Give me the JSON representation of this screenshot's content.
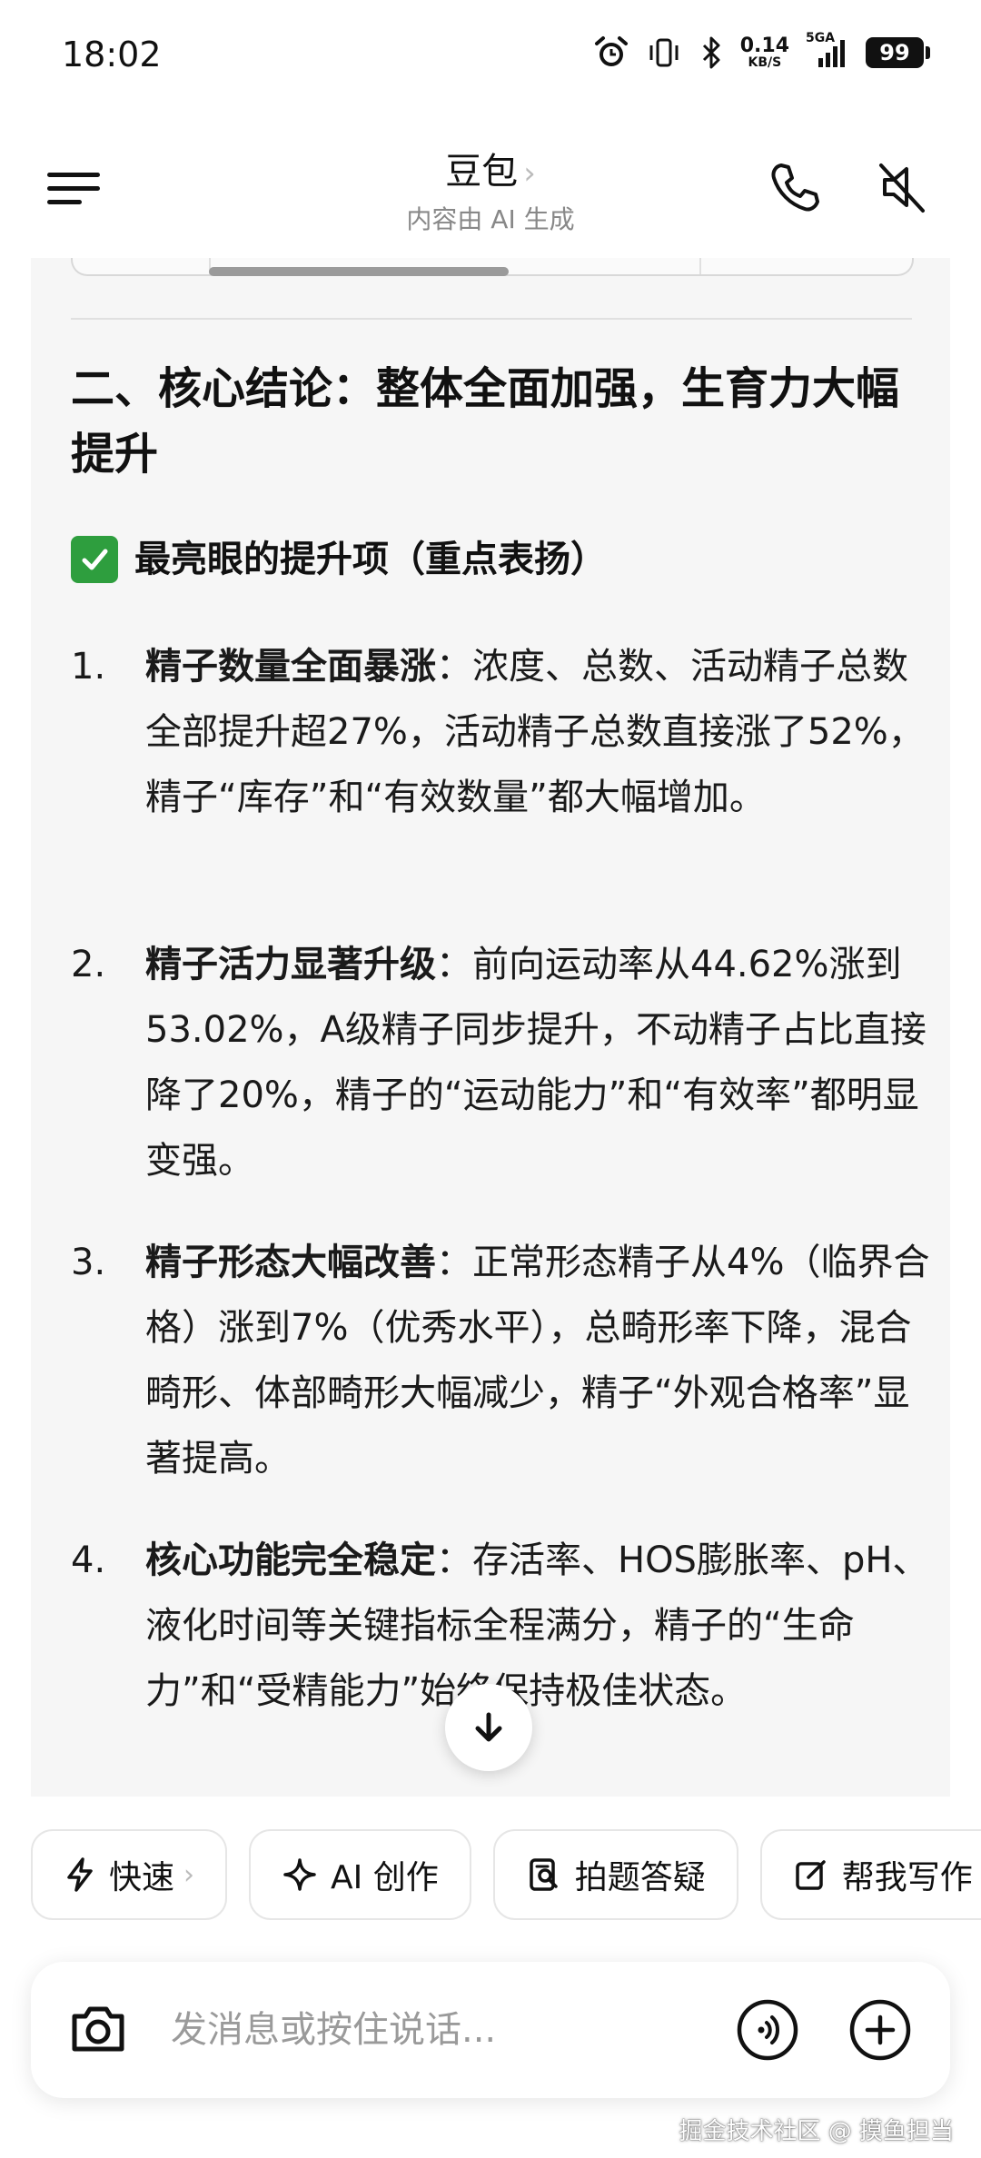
{
  "status_bar": {
    "time": "18:02",
    "net_speed_value": "0.14",
    "net_speed_unit": "KB/S",
    "network_type": "5GA",
    "battery": "99"
  },
  "header": {
    "title": "豆包",
    "title_chevron": "›",
    "subtitle": "内容由 AI 生成"
  },
  "content": {
    "heading": "二、核心结论：整体全面加强，生育力大幅提升",
    "subheading": "最亮眼的提升项（重点表扬）",
    "items": [
      {
        "num": "1.",
        "bold": "精子数量全面暴涨",
        "text": "：浓度、总数、活动精子总数全部提升超27%，活动精子总数直接涨了52%，精子“库存”和“有效数量”都大幅增加。"
      },
      {
        "num": "2.",
        "bold": "精子活力显著升级",
        "text": "：前向运动率从44.62%涨到53.02%，A级精子同步提升，不动精子占比直接降了20%，精子的“运动能力”和“有效率”都明显变强。"
      },
      {
        "num": "3.",
        "bold": "精子形态大幅改善",
        "text": "：正常形态精子从4%（临界合格）涨到7%（优秀水平），总畸形率下降，混合畸形、体部畸形大幅减少，精子“外观合格率”显著提高。"
      },
      {
        "num": "4.",
        "bold": "核心功能完全稳定",
        "text": "：存活率、HOS膨胀率、pH、液化时间等关键指标全程满分，精子的“生命力”和“受精能力”始终保持极佳状态。"
      }
    ]
  },
  "chips": [
    {
      "label": "快速",
      "icon": "lightning-icon",
      "has_arrow": true,
      "arrow": "›"
    },
    {
      "label": "AI 创作",
      "icon": "sparkle-icon"
    },
    {
      "label": "拍题答疑",
      "icon": "photo-question-icon"
    },
    {
      "label": "帮我写作",
      "icon": "edit-icon"
    }
  ],
  "input": {
    "placeholder": "发消息或按住说话..."
  },
  "watermark": "掘金技术社区 @ 摸鱼担当",
  "colors": {
    "card_bg": "#f6f6f6",
    "check_green": "#2e9e3e",
    "muted_text": "#888888"
  }
}
